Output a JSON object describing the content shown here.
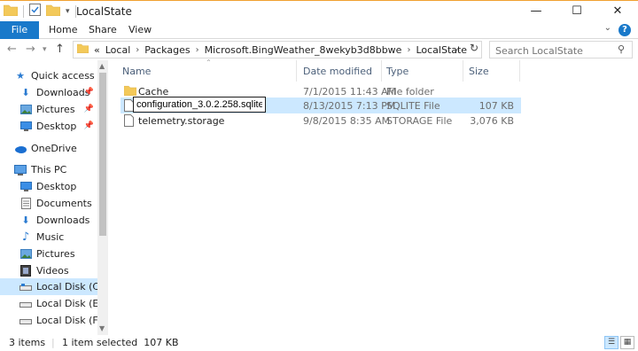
{
  "window": {
    "title": "LocalState",
    "controls": [
      "minimize",
      "maximize",
      "close"
    ]
  },
  "ribbon": {
    "tabs": [
      "File",
      "Home",
      "Share",
      "View"
    ],
    "help": "?"
  },
  "nav": {
    "breadcrumb": [
      "«",
      "Local",
      "Packages",
      "Microsoft.BingWeather_8wekyb3d8bbwe",
      "LocalState"
    ],
    "search_placeholder": "Search LocalState"
  },
  "sidebar": {
    "items": [
      {
        "label": "Quick access",
        "icon": "star-icon",
        "indent": 0,
        "pinned": false
      },
      {
        "label": "Downloads",
        "icon": "download-icon",
        "indent": 1,
        "pinned": true
      },
      {
        "label": "Pictures",
        "icon": "pictures-icon",
        "indent": 1,
        "pinned": true
      },
      {
        "label": "Desktop",
        "icon": "desktop-icon",
        "indent": 1,
        "pinned": true
      },
      {
        "label": "OneDrive",
        "icon": "cloud-icon",
        "indent": 0,
        "pinned": false
      },
      {
        "label": "This PC",
        "icon": "computer-icon",
        "indent": 0,
        "pinned": false
      },
      {
        "label": "Desktop",
        "icon": "desktop-icon",
        "indent": 1,
        "pinned": false
      },
      {
        "label": "Documents",
        "icon": "documents-icon",
        "indent": 1,
        "pinned": false
      },
      {
        "label": "Downloads",
        "icon": "download-icon",
        "indent": 1,
        "pinned": false
      },
      {
        "label": "Music",
        "icon": "music-icon",
        "indent": 1,
        "pinned": false
      },
      {
        "label": "Pictures",
        "icon": "pictures-icon",
        "indent": 1,
        "pinned": false
      },
      {
        "label": "Videos",
        "icon": "videos-icon",
        "indent": 1,
        "pinned": false
      },
      {
        "label": "Local Disk (C:)",
        "icon": "drive-icon",
        "indent": 1,
        "pinned": false,
        "selected": true
      },
      {
        "label": "Local Disk (E:)",
        "icon": "drive-icon",
        "indent": 1,
        "pinned": false
      },
      {
        "label": "Local Disk (F:)",
        "icon": "drive-icon",
        "indent": 1,
        "pinned": false
      }
    ]
  },
  "columns": {
    "name": "Name",
    "date": "Date modified",
    "type": "Type",
    "size": "Size"
  },
  "files": [
    {
      "name": "Cache",
      "date": "7/1/2015 11:43 AM",
      "type": "File folder",
      "size": "",
      "icon": "folder-icon",
      "selected": false,
      "renaming": false
    },
    {
      "name": "configuration_3.0.2.258.sqlite",
      "date": "8/13/2015 7:13 PM",
      "type": "SQLITE File",
      "size": "107 KB",
      "icon": "file-icon",
      "selected": true,
      "renaming": true
    },
    {
      "name": "telemetry.storage",
      "date": "9/8/2015 8:35 AM",
      "type": "STORAGE File",
      "size": "3,076 KB",
      "icon": "file-icon",
      "selected": false,
      "renaming": false
    }
  ],
  "status": {
    "count": "3 items",
    "selection": "1 item selected  107 KB"
  },
  "colors": {
    "accent": "#1979ca",
    "selection": "#cce8ff",
    "folder": "#f3c95a"
  }
}
